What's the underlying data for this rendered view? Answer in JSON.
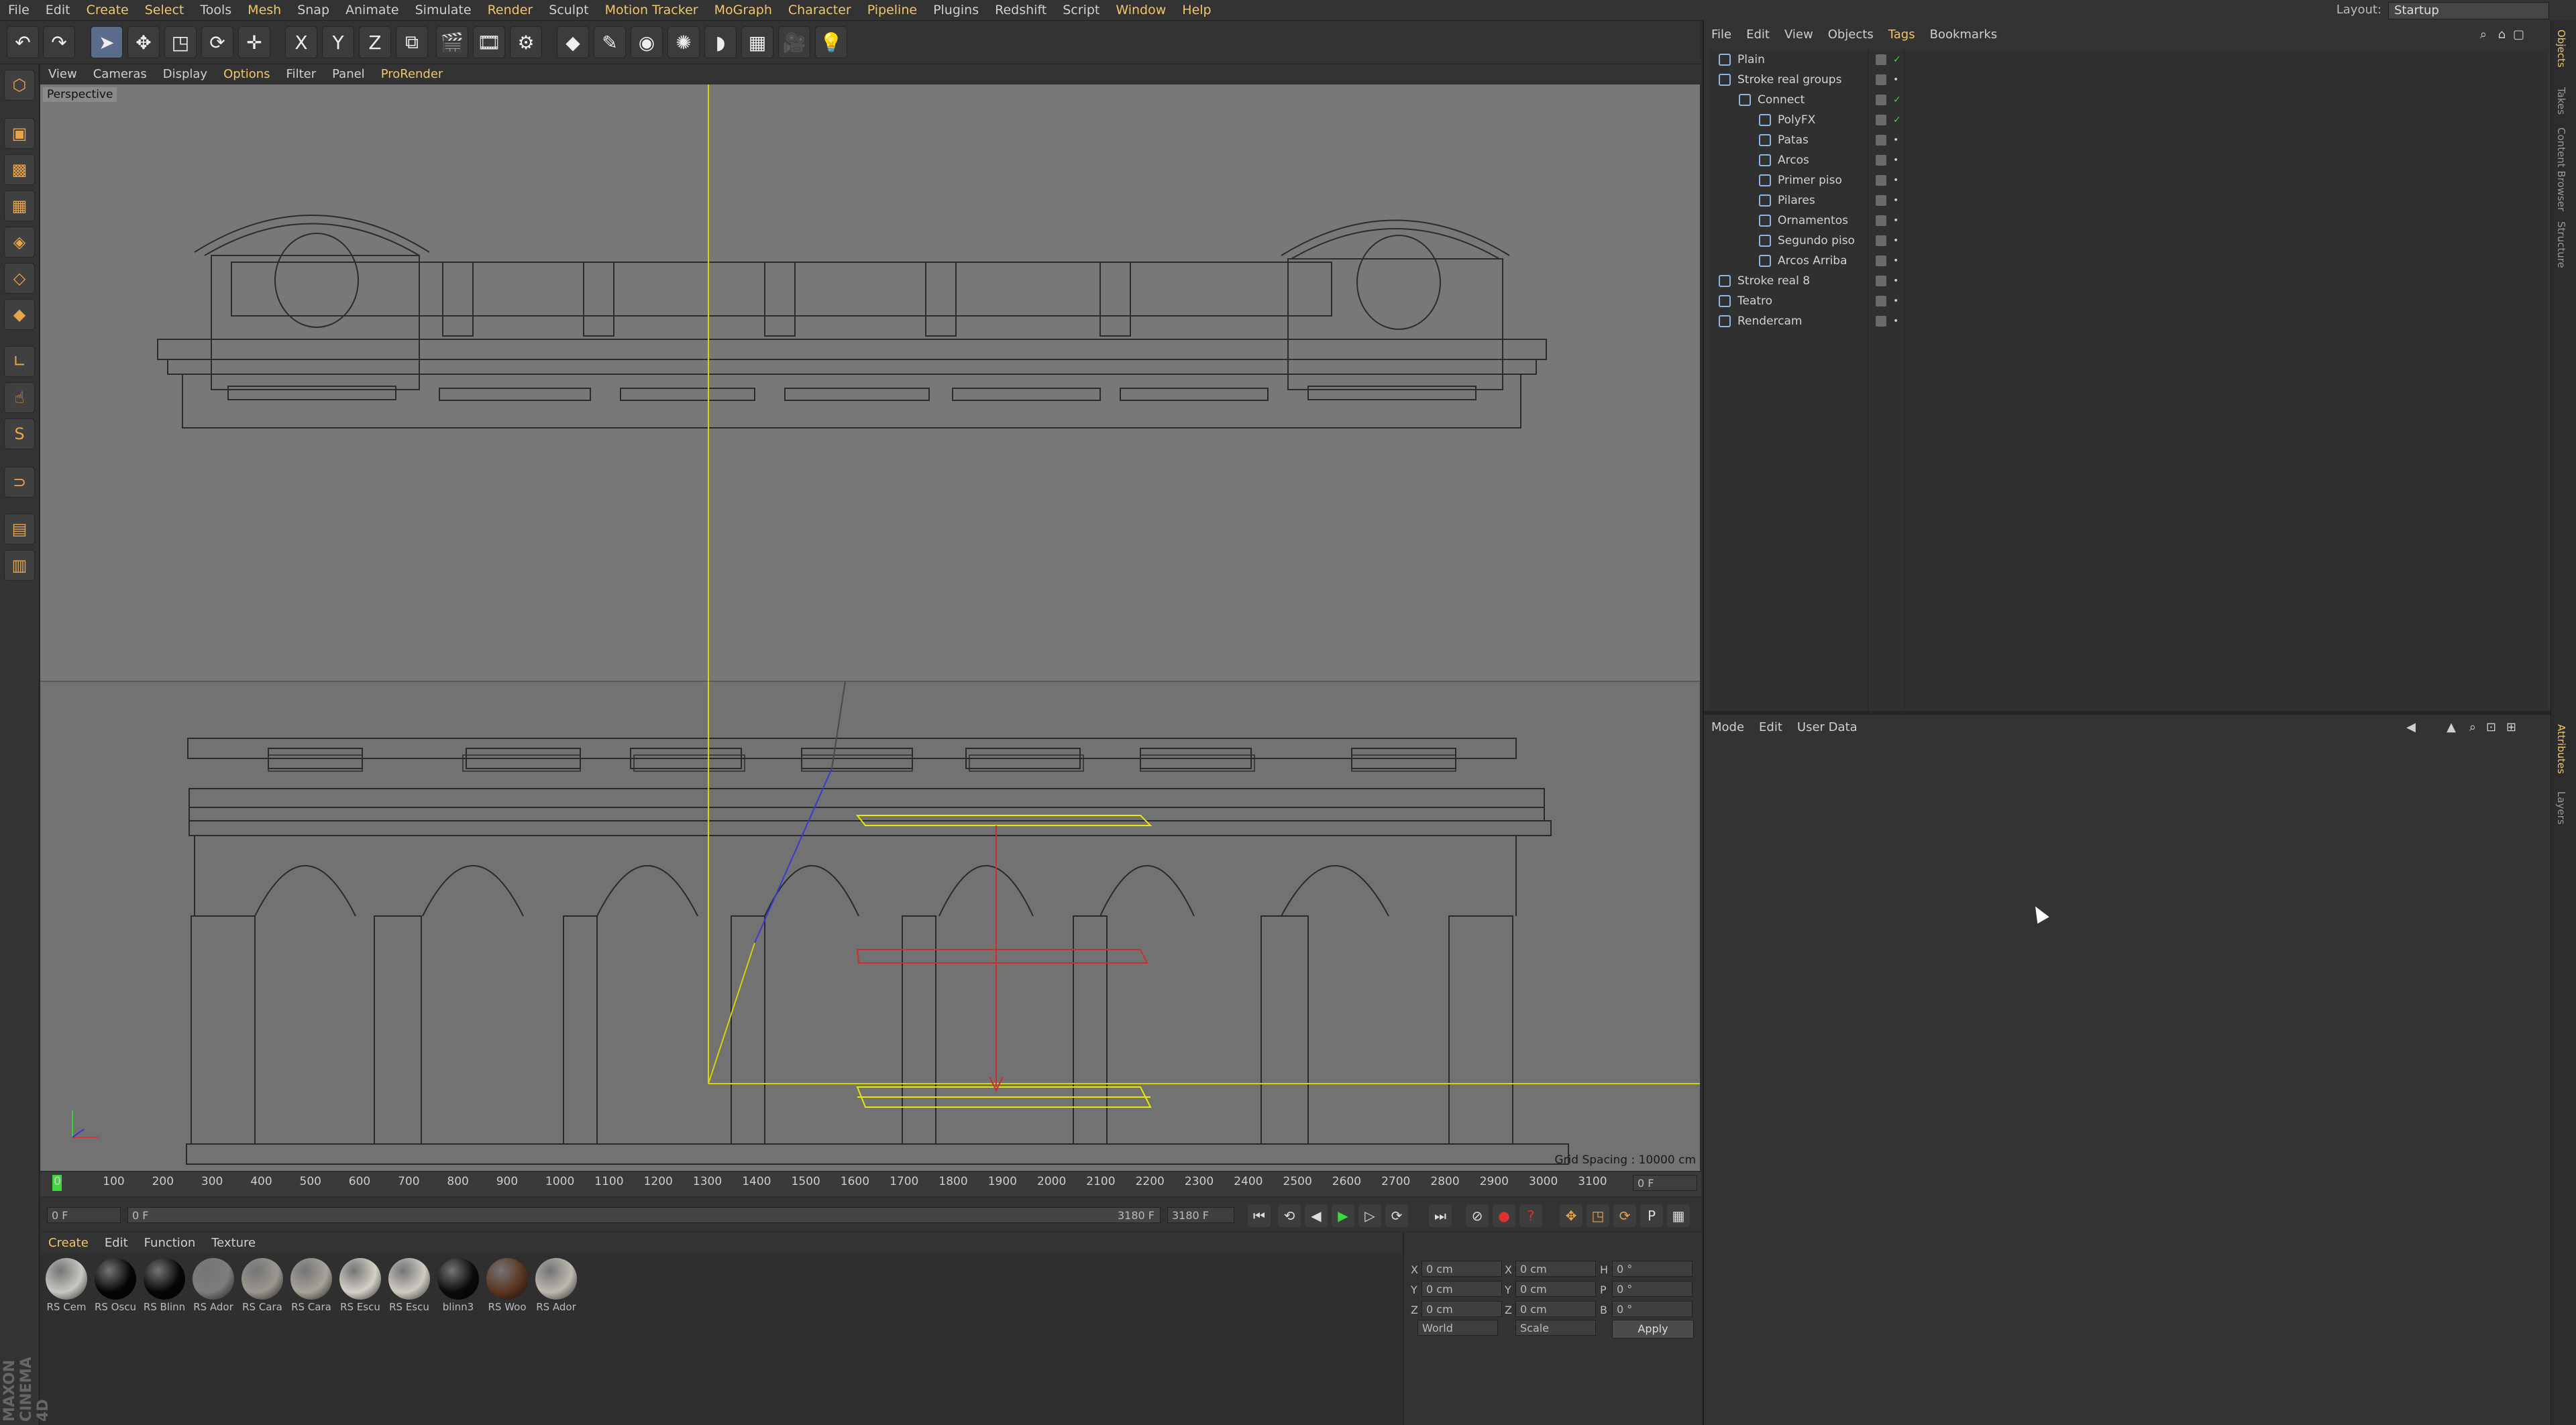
{
  "menubar": {
    "items": [
      "File",
      "Edit",
      "Create",
      "Select",
      "Tools",
      "Mesh",
      "Snap",
      "Animate",
      "Simulate",
      "Render",
      "Sculpt",
      "Motion Tracker",
      "MoGraph",
      "Character",
      "Pipeline",
      "Plugins",
      "Redshift",
      "Script",
      "Window",
      "Help"
    ],
    "layout_label": "Layout:",
    "layout_value": "Startup"
  },
  "toolbar": {
    "axis_x": "X",
    "axis_y": "Y",
    "axis_z": "Z"
  },
  "viewport": {
    "menu": [
      "View",
      "Cameras",
      "Display",
      "Options",
      "Filter",
      "Panel",
      "ProRender"
    ],
    "label": "Perspective",
    "grid_spacing": "Grid Spacing : 10000 cm"
  },
  "timeline": {
    "ticks": [
      "0",
      "100",
      "200",
      "300",
      "400",
      "500",
      "600",
      "700",
      "800",
      "900",
      "1000",
      "1100",
      "1200",
      "1300",
      "1400",
      "1500",
      "1600",
      "1700",
      "1800",
      "1900",
      "2000",
      "2100",
      "2200",
      "2300",
      "2400",
      "2500",
      "2600",
      "2700",
      "2800",
      "2900",
      "3000",
      "3100"
    ],
    "current_frame": "0 F",
    "start_field": "0 F",
    "range_start": "0 F",
    "range_end": "3180 F",
    "end_field": "3180 F"
  },
  "materials": {
    "menu": [
      "Create",
      "Edit",
      "Function",
      "Texture"
    ],
    "items": [
      {
        "label": "RS Cem",
        "color": "#c9c7c2"
      },
      {
        "label": "RS Oscu",
        "color": "#050505"
      },
      {
        "label": "RS Blinn",
        "color": "#060606"
      },
      {
        "label": "RS Ador",
        "color": "#7d7d7d"
      },
      {
        "label": "RS Cara",
        "color": "#9b9790"
      },
      {
        "label": "RS Cara",
        "color": "#a7a39b"
      },
      {
        "label": "RS Escu",
        "color": "#d4d0c8"
      },
      {
        "label": "RS Escu",
        "color": "#cfcbc3"
      },
      {
        "label": "blinn3",
        "color": "#0a0a0a"
      },
      {
        "label": "RS Woo",
        "color": "#5a3520"
      },
      {
        "label": "RS Ador",
        "color": "#bdb9b1"
      }
    ]
  },
  "coords": {
    "x_pos": "0 cm",
    "y_pos": "0 cm",
    "z_pos": "0 cm",
    "x_size": "0 cm",
    "y_size": "0 cm",
    "z_size": "0 cm",
    "h": "0 °",
    "p": "0 °",
    "b": "0 °",
    "world": "World",
    "scale": "Scale",
    "apply": "Apply"
  },
  "brand": "MAXON CINEMA 4D",
  "objects": {
    "menu": [
      "File",
      "Edit",
      "View",
      "Objects",
      "Tags",
      "Bookmarks"
    ],
    "rows": [
      {
        "name": "Plain",
        "indent": 0,
        "status": "✓"
      },
      {
        "name": "Stroke real groups",
        "indent": 0,
        "status": "•"
      },
      {
        "name": "Connect",
        "indent": 1,
        "status": "✓"
      },
      {
        "name": "PolyFX",
        "indent": 2,
        "status": "✓"
      },
      {
        "name": "Patas",
        "indent": 2,
        "status": "•"
      },
      {
        "name": "Arcos",
        "indent": 2,
        "status": "•"
      },
      {
        "name": "Primer piso",
        "indent": 2,
        "status": "•"
      },
      {
        "name": "Pilares",
        "indent": 2,
        "status": "•"
      },
      {
        "name": "Ornamentos",
        "indent": 2,
        "status": "•"
      },
      {
        "name": "Segundo piso",
        "indent": 2,
        "status": "•"
      },
      {
        "name": "Arcos Arriba",
        "indent": 2,
        "status": "•"
      },
      {
        "name": "Stroke real 8",
        "indent": 0,
        "status": "•"
      },
      {
        "name": "Teatro",
        "indent": 0,
        "status": "•"
      },
      {
        "name": "Rendercam",
        "indent": 0,
        "status": "•"
      }
    ]
  },
  "attributes": {
    "menu": [
      "Mode",
      "Edit",
      "User Data"
    ]
  },
  "sidetabs": [
    "Objects",
    "Takes",
    "Content Browser",
    "Structure",
    "Attributes",
    "Layers"
  ]
}
